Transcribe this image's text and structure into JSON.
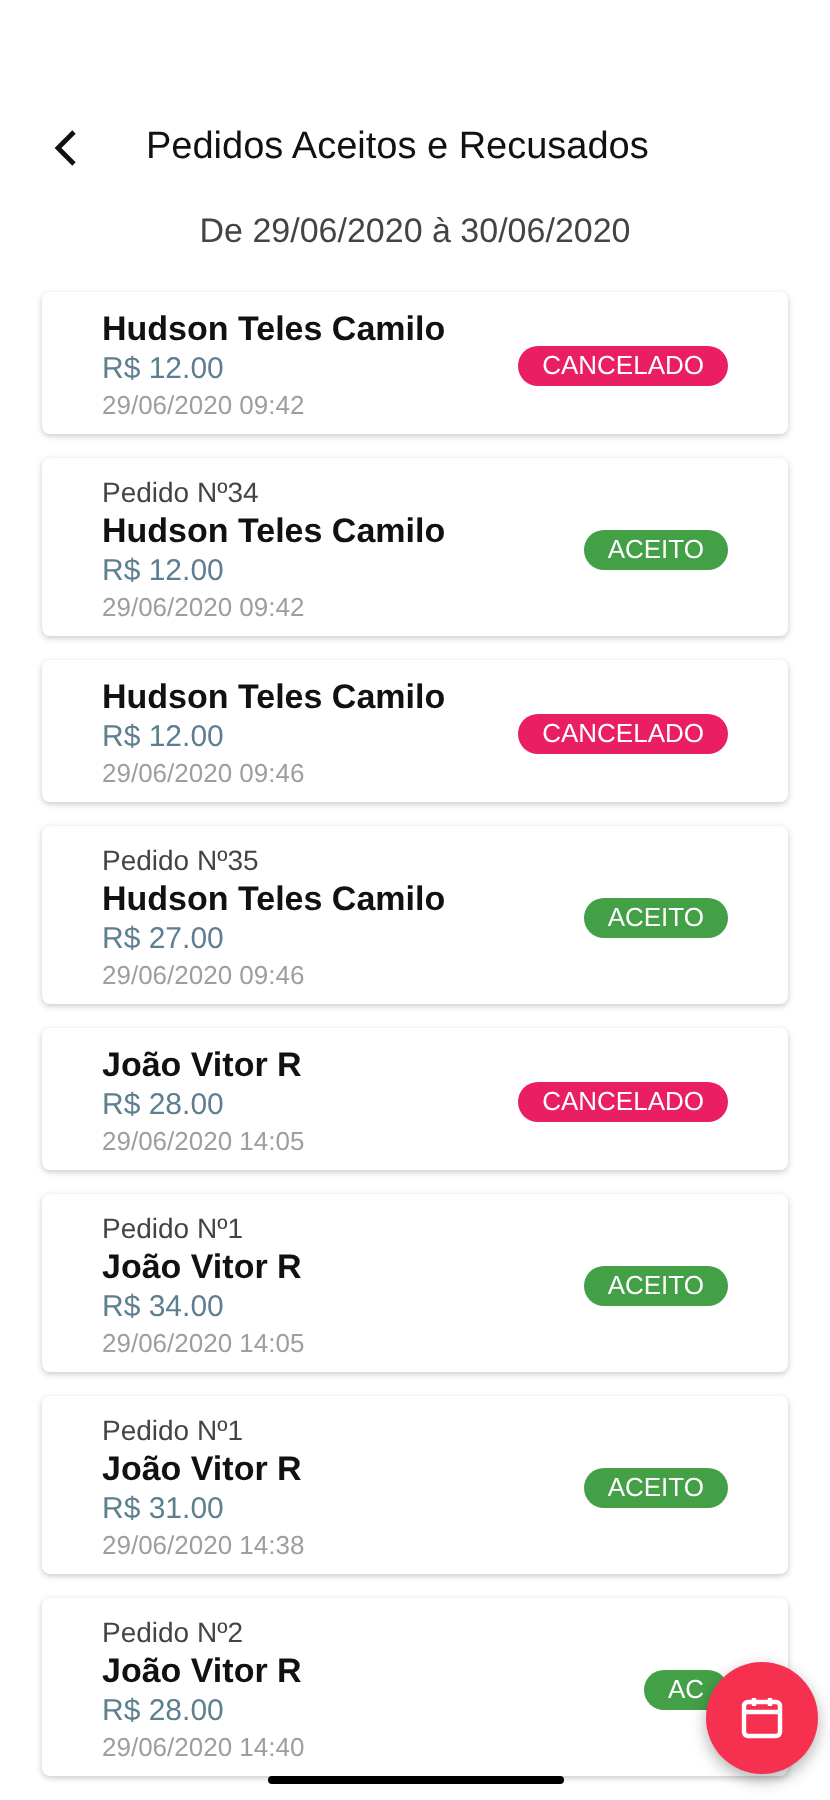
{
  "header": {
    "title": "Pedidos Aceitos e Recusados",
    "date_range": "De 29/06/2020 à 30/06/2020"
  },
  "orders": [
    {
      "name": "Hudson Teles Camilo",
      "price": "R$ 12.00",
      "datetime": "29/06/2020 09:42",
      "status": "CANCELADO",
      "kind": "cancelled"
    },
    {
      "order_number": "Pedido Nº34",
      "name": "Hudson Teles Camilo",
      "price": "R$ 12.00",
      "datetime": "29/06/2020 09:42",
      "status": "ACEITO",
      "kind": "accepted"
    },
    {
      "name": "Hudson Teles Camilo",
      "price": "R$ 12.00",
      "datetime": "29/06/2020 09:46",
      "status": "CANCELADO",
      "kind": "cancelled"
    },
    {
      "order_number": "Pedido Nº35",
      "name": "Hudson Teles Camilo",
      "price": "R$ 27.00",
      "datetime": "29/06/2020 09:46",
      "status": "ACEITO",
      "kind": "accepted"
    },
    {
      "name": "João Vitor R",
      "price": "R$ 28.00",
      "datetime": "29/06/2020 14:05",
      "status": "CANCELADO",
      "kind": "cancelled"
    },
    {
      "order_number": "Pedido Nº1",
      "name": "João Vitor R",
      "price": "R$ 34.00",
      "datetime": "29/06/2020 14:05",
      "status": "ACEITO",
      "kind": "accepted"
    },
    {
      "order_number": "Pedido Nº1",
      "name": "João Vitor R",
      "price": "R$ 31.00",
      "datetime": "29/06/2020 14:38",
      "status": "ACEITO",
      "kind": "accepted"
    },
    {
      "order_number": "Pedido Nº2",
      "name": "João Vitor R",
      "price": "R$ 28.00",
      "datetime": "29/06/2020 14:40",
      "status": "AC",
      "kind": "accepted"
    }
  ]
}
